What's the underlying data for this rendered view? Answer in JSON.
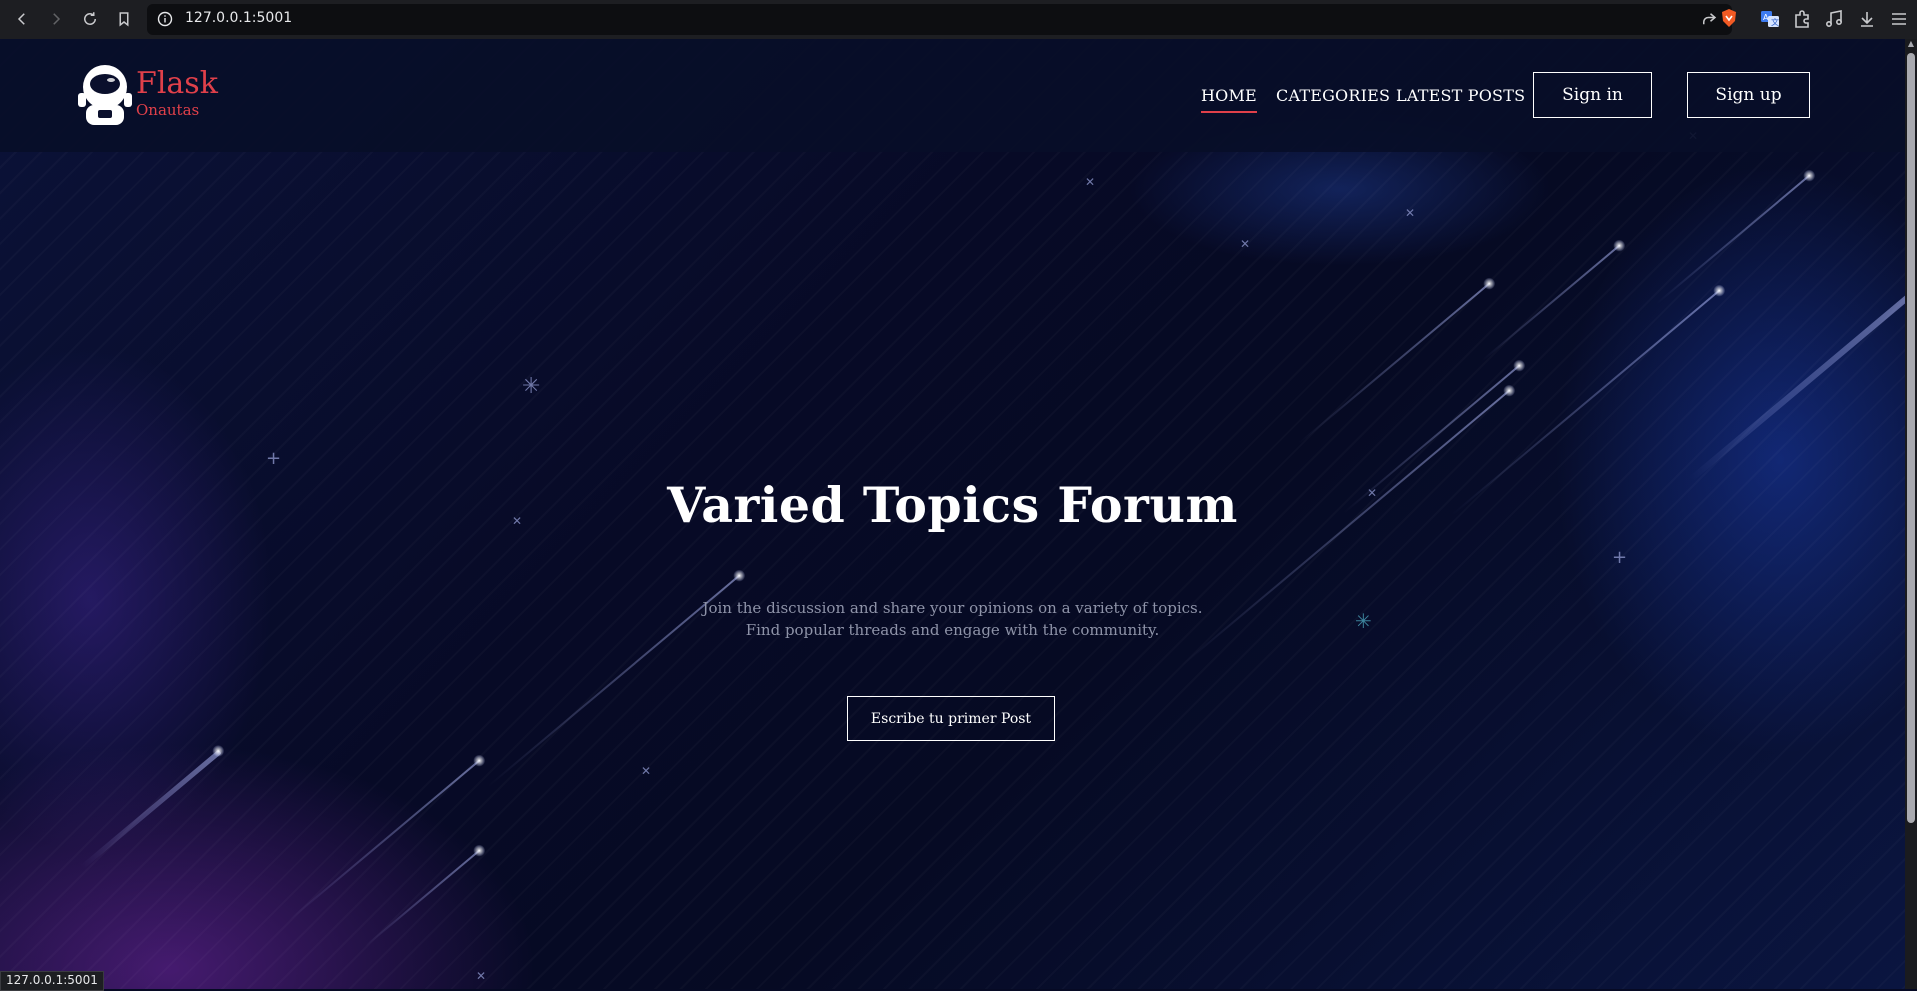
{
  "browser": {
    "url": "127.0.0.1:5001",
    "icons": [
      "back-icon",
      "forward-icon",
      "reload-icon",
      "bookmark-icon",
      "site-info-icon",
      "share-icon",
      "brave-shield-icon",
      "translate-icon",
      "extensions-icon",
      "media-icon",
      "download-icon",
      "menu-icon"
    ]
  },
  "site": {
    "logo_main": "Flask",
    "logo_sub": "Onautas",
    "nav": [
      "HOME",
      "CATEGORIES",
      "LATEST POSTS"
    ],
    "active_nav": "HOME",
    "signin_label": "Sign in",
    "signup_label": "Sign up",
    "accent_color": "#e0404a"
  },
  "hero": {
    "title": "Varied Topics Forum",
    "desc_line1": "Join the discussion and share your opinions on a variety of topics.",
    "desc_line2": "Find popular threads and engage with the community.",
    "cta_label": "Escribe tu primer Post"
  },
  "status_bar": {
    "text": "127.0.0.1:5001"
  }
}
